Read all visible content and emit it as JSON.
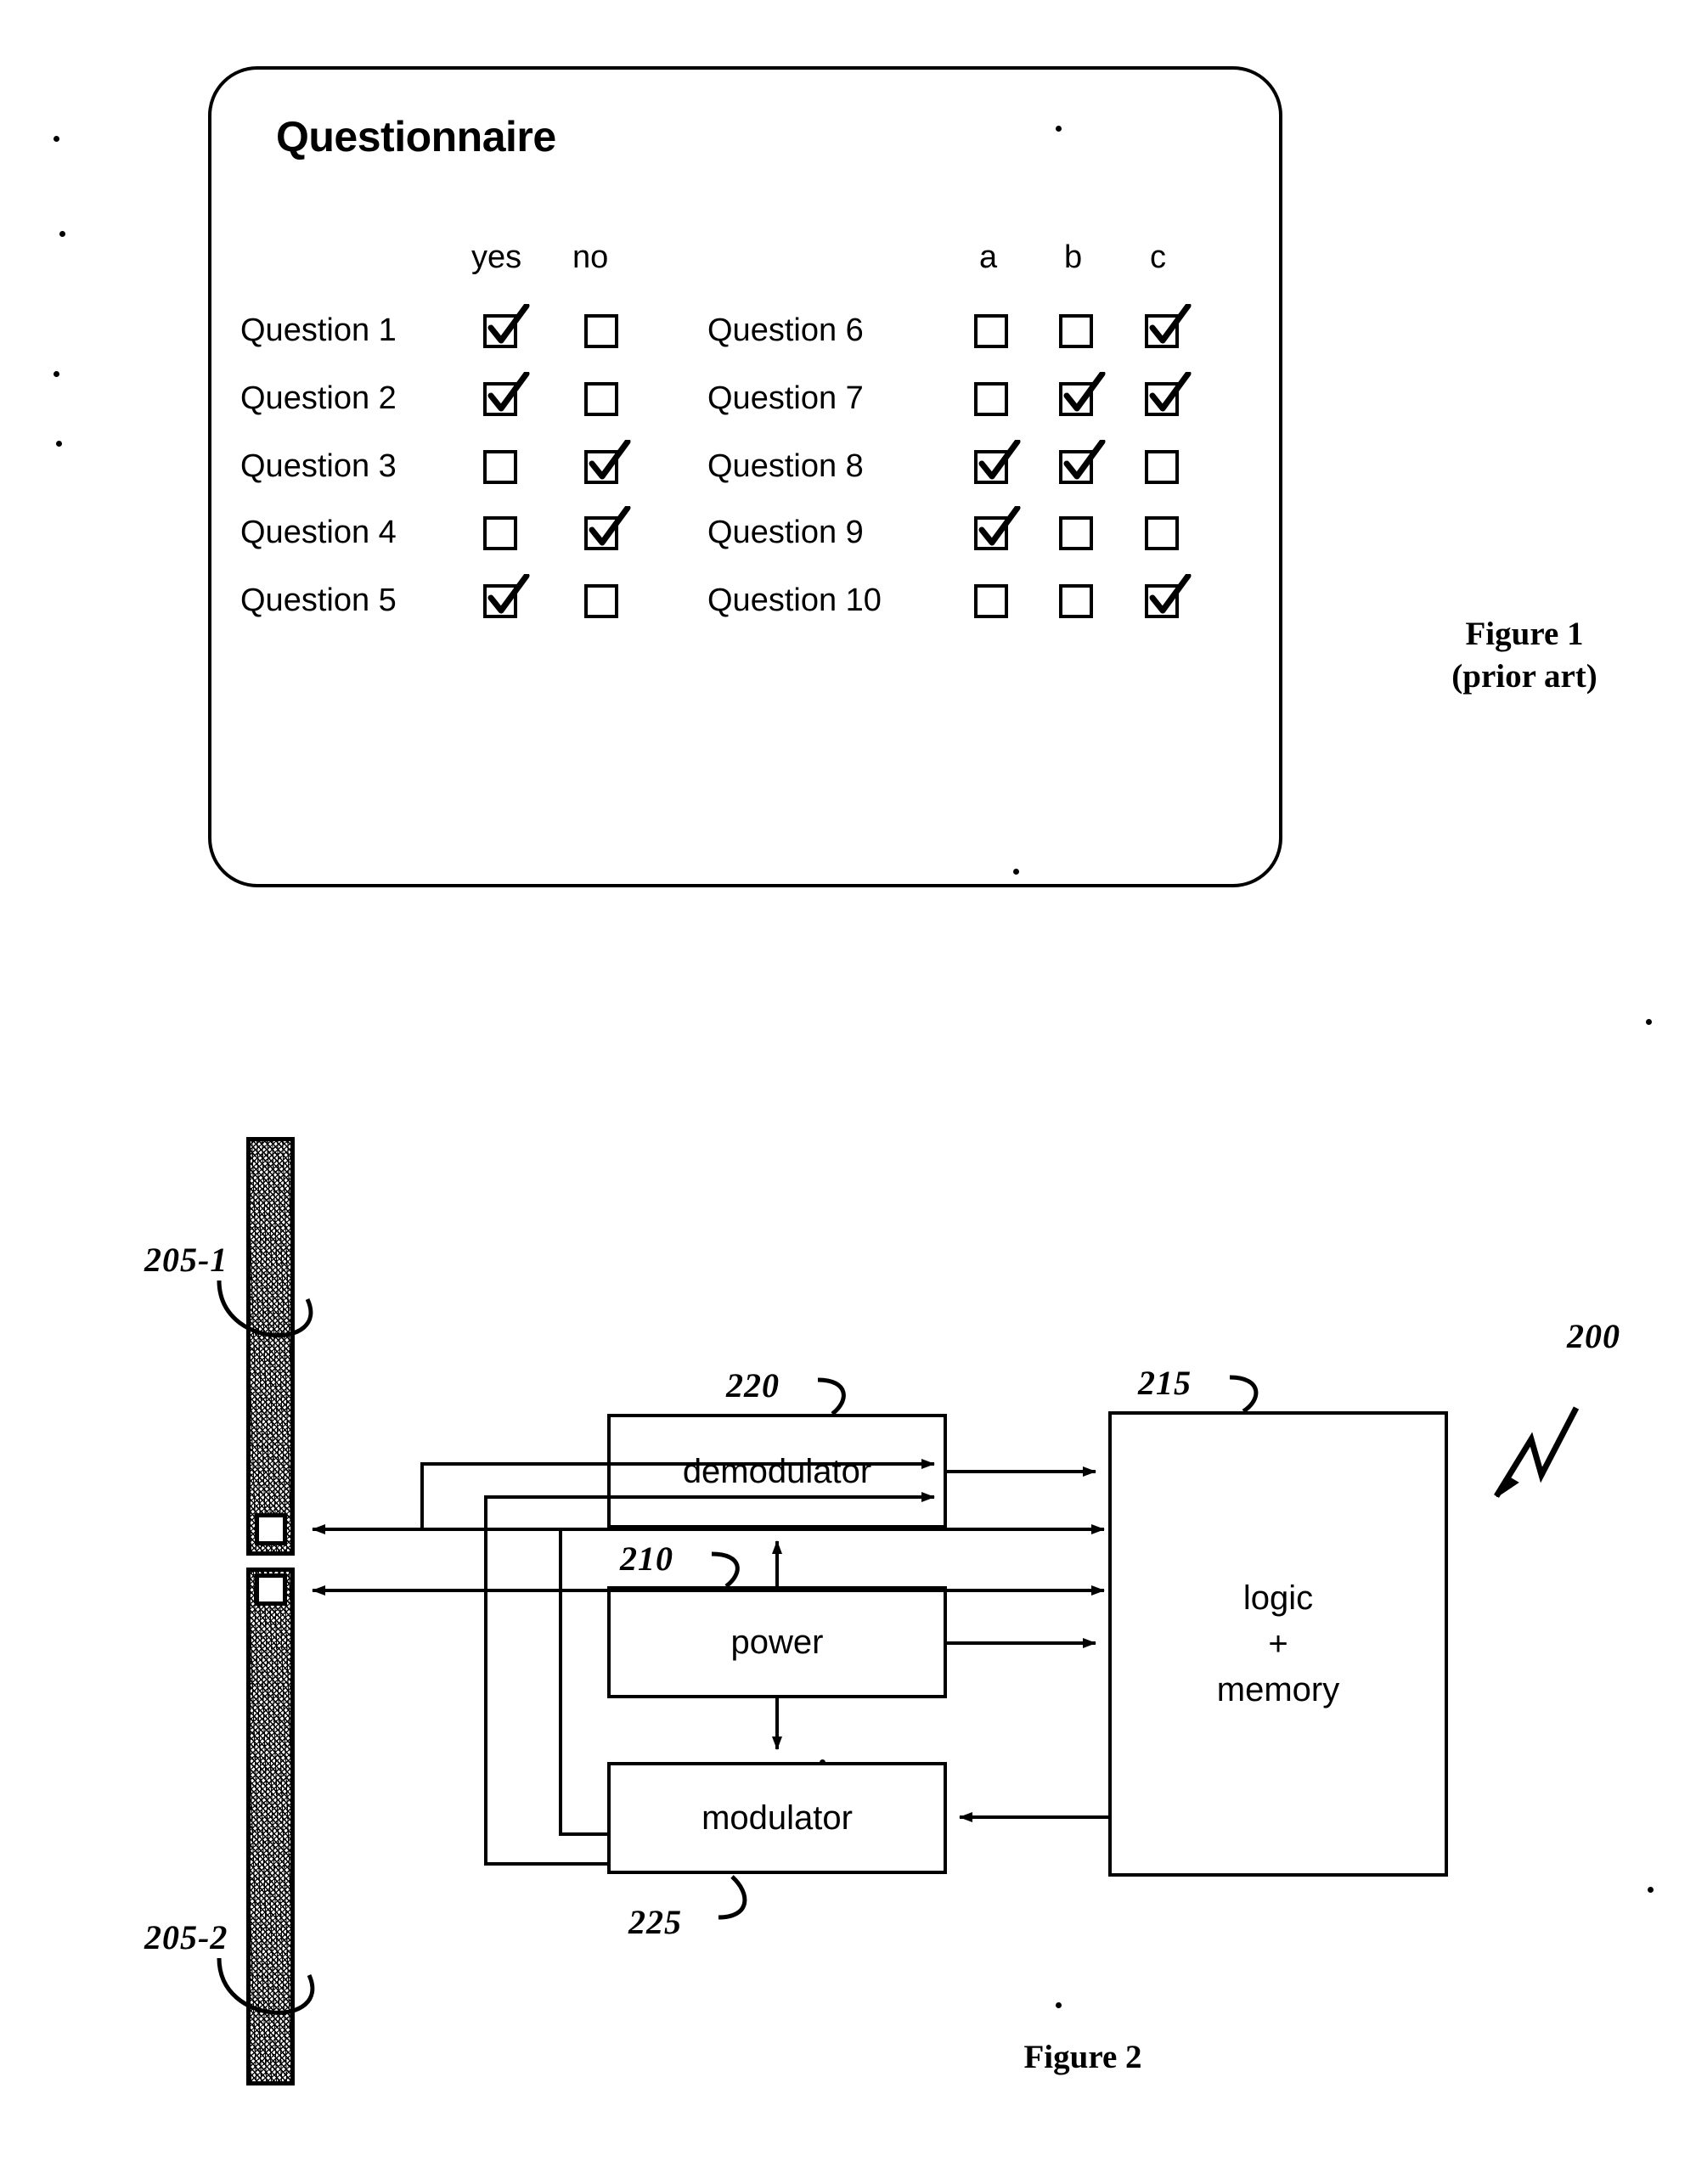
{
  "figure1": {
    "title": "Questionnaire",
    "caption_line1": "Figure 1",
    "caption_line2": "(prior art)",
    "left_column": {
      "headers": [
        "yes",
        "no"
      ],
      "rows": [
        {
          "label": "Question 1",
          "checks": [
            true,
            false
          ]
        },
        {
          "label": "Question 2",
          "checks": [
            true,
            false
          ]
        },
        {
          "label": "Question 3",
          "checks": [
            false,
            true
          ]
        },
        {
          "label": "Question 4",
          "checks": [
            false,
            true
          ]
        },
        {
          "label": "Question 5",
          "checks": [
            true,
            false
          ]
        }
      ]
    },
    "right_column": {
      "headers": [
        "a",
        "b",
        "c"
      ],
      "rows": [
        {
          "label": "Question 6",
          "checks": [
            false,
            false,
            true
          ]
        },
        {
          "label": "Question 7",
          "checks": [
            false,
            true,
            true
          ]
        },
        {
          "label": "Question 8",
          "checks": [
            true,
            true,
            false
          ]
        },
        {
          "label": "Question 9",
          "checks": [
            true,
            false,
            false
          ]
        },
        {
          "label": "Question 10",
          "checks": [
            false,
            false,
            true
          ]
        }
      ]
    }
  },
  "figure2": {
    "caption": "Figure 2",
    "reference_numeral": "200",
    "antennas": [
      {
        "ref": "205-1"
      },
      {
        "ref": "205-2"
      }
    ],
    "blocks": [
      {
        "ref": "220",
        "label": "demodulator"
      },
      {
        "ref": "210",
        "label": "power"
      },
      {
        "ref": "225",
        "label": "modulator"
      },
      {
        "ref": "215",
        "label_line1": "logic",
        "label_line2": "+",
        "label_line3": "memory"
      }
    ]
  }
}
